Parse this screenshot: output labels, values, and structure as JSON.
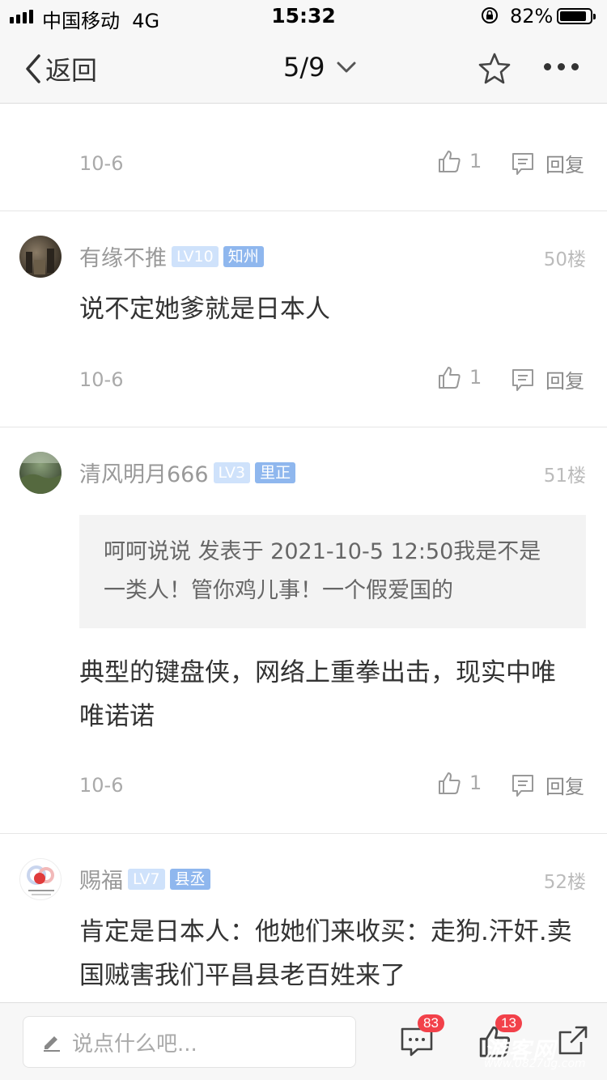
{
  "status_bar": {
    "carrier": "中国移动",
    "network": "4G",
    "time": "15:32",
    "battery": "82%"
  },
  "nav": {
    "back_label": "返回",
    "pager": "5/9"
  },
  "prev_post": {
    "cut_text": "…",
    "date": "10-6",
    "likes": "1",
    "reply_label": "回复"
  },
  "posts": [
    {
      "username": "有缘不推",
      "level": "LV10",
      "title": "知州",
      "floor": "50楼",
      "text": "说不定她爹就是日本人",
      "date": "10-6",
      "likes": "1",
      "reply_label": "回复"
    },
    {
      "username": "清风明月666",
      "level": "LV3",
      "title": "里正",
      "floor": "51楼",
      "quote": "呵呵说说 发表于 2021-10-5 12:50我是不是一类人！管你鸡儿事！一个假爱国的",
      "text": "典型的键盘侠，网络上重拳出击，现实中唯唯诺诺",
      "date": "10-6",
      "likes": "1",
      "reply_label": "回复"
    },
    {
      "username": "赐福",
      "level": "LV7",
      "title": "县丞",
      "floor": "52楼",
      "text": "肯定是日本人：他她们来收买：走狗.汗奸.卖国贼害我们平昌县老百姓来了"
    }
  ],
  "bottom_bar": {
    "input_placeholder": "说点什么吧...",
    "comment_count": "83",
    "like_count": "13"
  },
  "watermark": {
    "line1": "游客网",
    "line2": "www.0827ug.com"
  },
  "colors": {
    "level_badge": "#cfe2fb",
    "title_badge": "#8fb7ee",
    "count_badge": "#f2414a"
  },
  "icons": [
    "back-chevron-icon",
    "dropdown-chevron-icon",
    "star-icon",
    "more-icon",
    "thumbs-up-icon",
    "reply-bubble-icon",
    "edit-pencil-icon",
    "comment-icon",
    "share-icon"
  ]
}
